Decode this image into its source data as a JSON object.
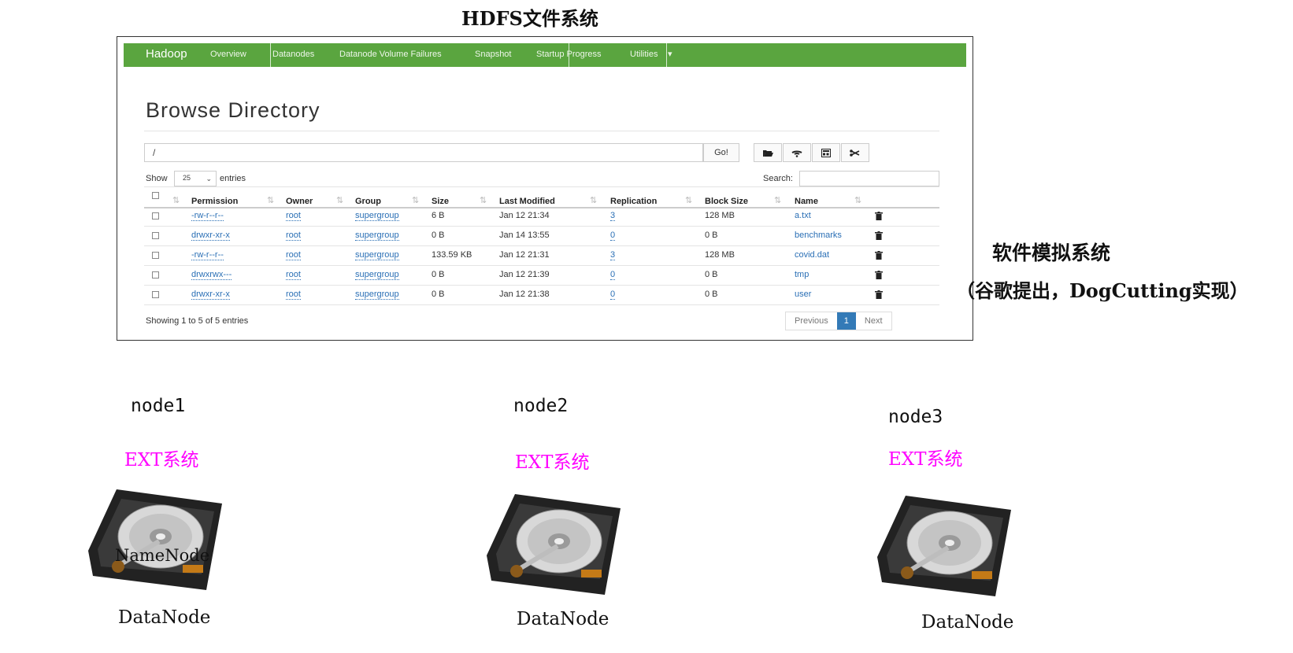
{
  "diagram_title": "HDFS文件系统",
  "hdfs_ui": {
    "navbar": {
      "brand": "Hadoop",
      "items": [
        "Overview",
        "Datanodes",
        "Datanode Volume Failures",
        "Snapshot",
        "Startup Progress",
        "Utilities"
      ]
    },
    "heading": "Browse Directory",
    "path_value": "/",
    "go_label": "Go!",
    "toolbar_icons": [
      "folder-open-icon",
      "upload-icon",
      "create-directory-icon",
      "cut-icon"
    ],
    "show_label": "Show",
    "page_size": "25",
    "entries_label": "entries",
    "search_label": "Search:",
    "columns": [
      "Permission",
      "Owner",
      "Group",
      "Size",
      "Last Modified",
      "Replication",
      "Block Size",
      "Name"
    ],
    "rows": [
      {
        "permission": "-rw-r--r--",
        "owner": "root",
        "group": "supergroup",
        "size": "6 B",
        "modified": "Jan 12 21:34",
        "replication": "3",
        "block_size": "128 MB",
        "name": "a.txt"
      },
      {
        "permission": "drwxr-xr-x",
        "owner": "root",
        "group": "supergroup",
        "size": "0 B",
        "modified": "Jan 14 13:55",
        "replication": "0",
        "block_size": "0 B",
        "name": "benchmarks"
      },
      {
        "permission": "-rw-r--r--",
        "owner": "root",
        "group": "supergroup",
        "size": "133.59 KB",
        "modified": "Jan 12 21:31",
        "replication": "3",
        "block_size": "128 MB",
        "name": "covid.dat"
      },
      {
        "permission": "drwxrwx---",
        "owner": "root",
        "group": "supergroup",
        "size": "0 B",
        "modified": "Jan 12 21:39",
        "replication": "0",
        "block_size": "0 B",
        "name": "tmp"
      },
      {
        "permission": "drwxr-xr-x",
        "owner": "root",
        "group": "supergroup",
        "size": "0 B",
        "modified": "Jan 12 21:38",
        "replication": "0",
        "block_size": "0 B",
        "name": "user"
      }
    ],
    "showing_text": "Showing 1 to 5 of 5 entries",
    "pagination": {
      "previous": "Previous",
      "current": "1",
      "next": "Next"
    }
  },
  "side_note": {
    "title": "软件模拟系统",
    "subtitle": "（谷歌提出，DogCutting实现）"
  },
  "nodes": [
    {
      "name": "node1",
      "fs": "EXT系统",
      "extra_role": "NameNode",
      "role": "DataNode"
    },
    {
      "name": "node2",
      "fs": "EXT系统",
      "role": "DataNode"
    },
    {
      "name": "node3",
      "fs": "EXT系统",
      "role": "DataNode"
    }
  ],
  "colors": {
    "navbar": "#5aa53f",
    "ext_label": "#ff00ff",
    "link": "#2a6fb5",
    "page_active": "#337ab7"
  }
}
